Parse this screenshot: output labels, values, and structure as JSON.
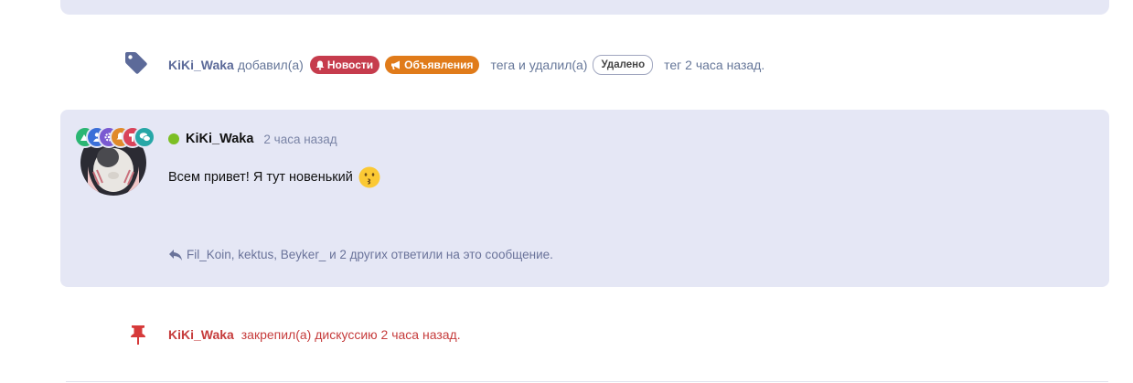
{
  "tag_event": {
    "user": "KiKi_Waka",
    "added_text": "добавил(а)",
    "added_tags": [
      "Новости",
      "Объявления"
    ],
    "removed_text": "тега и удалил(а)",
    "removed_tag": "Удалено",
    "suffix": "тег 2 часа назад."
  },
  "post": {
    "user": "KiKi_Waka",
    "time": "2 часа назад",
    "body": "Всем привет! Я тут новенький",
    "replies_text": "Fil_Koin, kektus, Beyker_ и 2 других ответили на это сообщение.",
    "online": true,
    "user_badges": [
      {
        "icon": "mountain-icon",
        "color": "#2bb673"
      },
      {
        "icon": "person-icon",
        "color": "#3b6fd8"
      },
      {
        "icon": "gear-icon",
        "color": "#7a5ad1"
      },
      {
        "icon": "bell-icon",
        "color": "#e08a2a"
      },
      {
        "icon": "hammer-icon",
        "color": "#d9435a"
      },
      {
        "icon": "comments-icon",
        "color": "#27a7a7"
      }
    ]
  },
  "pin_event": {
    "user": "KiKi_Waka",
    "text": "закрепил(а) дискуссию 2 часа назад."
  },
  "colors": {
    "card_bg": "#e5e7f5",
    "news_badge": "#c63c4d",
    "ads_badge": "#e07b1a",
    "pin_red": "#c63c3c",
    "online": "#7cbf24"
  }
}
